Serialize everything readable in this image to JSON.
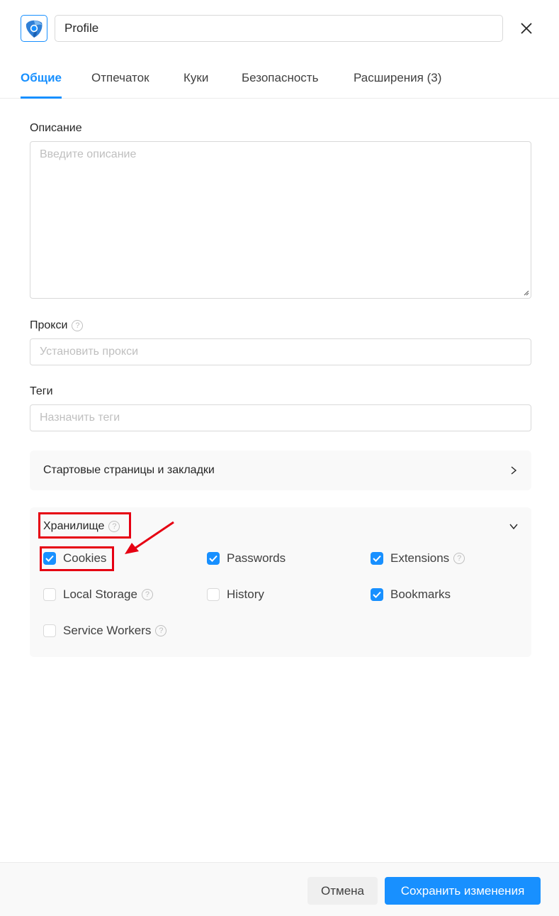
{
  "header": {
    "logo_icon": "browser-profile-logo-icon",
    "profile_name": "Profile",
    "close_icon": "close-icon"
  },
  "tabs": [
    {
      "label": "Общие",
      "active": true
    },
    {
      "label": "Отпечаток",
      "active": false
    },
    {
      "label": "Куки",
      "active": false
    },
    {
      "label": "Безопасность",
      "active": false
    },
    {
      "label": "Расширения (3)",
      "active": false
    }
  ],
  "description": {
    "label": "Описание",
    "value": "",
    "placeholder": "Введите описание"
  },
  "proxy": {
    "label": "Прокси",
    "value": "",
    "placeholder": "Установить прокси"
  },
  "tags": {
    "label": "Теги",
    "value": "",
    "placeholder": "Назначить теги"
  },
  "start_pages": {
    "title": "Стартовые страницы и закладки",
    "expanded": false
  },
  "storage": {
    "title": "Хранилище",
    "expanded": true,
    "options": [
      {
        "label": "Cookies",
        "checked": true,
        "help": false
      },
      {
        "label": "Passwords",
        "checked": true,
        "help": false
      },
      {
        "label": "Extensions",
        "checked": true,
        "help": true
      },
      {
        "label": "Local Storage",
        "checked": false,
        "help": true
      },
      {
        "label": "History",
        "checked": false,
        "help": false
      },
      {
        "label": "Bookmarks",
        "checked": true,
        "help": false
      },
      {
        "label": "Service Workers",
        "checked": false,
        "help": true
      }
    ]
  },
  "footer": {
    "cancel_label": "Отмена",
    "save_label": "Сохранить изменения"
  },
  "colors": {
    "accent": "#1890ff",
    "annotation": "#e60012"
  }
}
